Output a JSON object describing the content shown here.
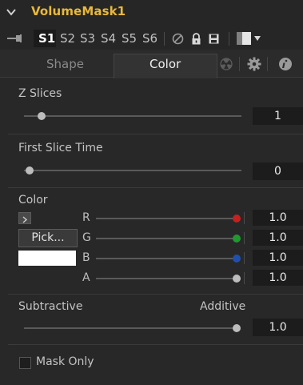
{
  "node": {
    "title": "VolumeMask1"
  },
  "toolbar": {
    "slots": [
      "S1",
      "S2",
      "S3",
      "S4",
      "S5",
      "S6"
    ],
    "active_slot": "S1"
  },
  "tabs": {
    "shape_label": "Shape",
    "color_label": "Color",
    "active": "Color",
    "icons": [
      "radioactive-icon",
      "gear-icon",
      "info-icon"
    ]
  },
  "controls": {
    "z_slices": {
      "label": "Z Slices",
      "value": "1",
      "level": 0.08
    },
    "first_slice_time": {
      "label": "First Slice Time",
      "value": "0",
      "level": 0.0
    },
    "color": {
      "label": "Color",
      "pick_label": "Pick...",
      "swatch_color": "#ffffff",
      "channels": [
        {
          "name": "R",
          "value": "1.0",
          "level": 1.0,
          "color": "#c81f1f"
        },
        {
          "name": "G",
          "value": "1.0",
          "level": 1.0,
          "color": "#1f9a2e"
        },
        {
          "name": "B",
          "value": "1.0",
          "level": 1.0,
          "color": "#1f4fb0"
        },
        {
          "name": "A",
          "value": "1.0",
          "level": 1.0,
          "color": "#bdbdbd"
        }
      ]
    },
    "subtractive_additive": {
      "left_label": "Subtractive",
      "right_label": "Additive",
      "value": "1.0",
      "level": 1.0
    },
    "mask_only": {
      "label": "Mask Only",
      "checked": false
    }
  },
  "colors": {
    "accent_title": "#e8b93b"
  }
}
